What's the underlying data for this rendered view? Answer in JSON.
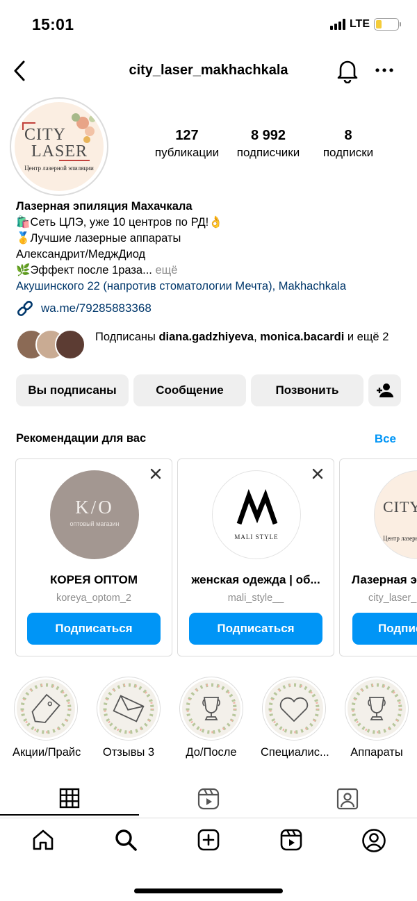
{
  "status": {
    "time": "15:01",
    "network": "LTE",
    "battery_level": 0.28,
    "battery_color": "#f4cc3a"
  },
  "header": {
    "username": "city_laser_makhachkala"
  },
  "profile": {
    "avatar": {
      "line1": "CITY",
      "line2": "LASER",
      "caption": "Центр лазерной эпиляции"
    },
    "stats": [
      {
        "num": "127",
        "label": "публикации"
      },
      {
        "num": "8 992",
        "label": "подписчики"
      },
      {
        "num": "8",
        "label": "подписки"
      }
    ],
    "bio": {
      "name": "Лазерная эпиляция Махачкала",
      "line1": "🛍️Сеть ЦЛЭ, уже 10 центров по РД!👌",
      "line2": "🥇Лучшие лазерные аппараты",
      "line3": "Александрит/МеджДиод",
      "line4": "🌿Эффект после 1раза...",
      "more": " ещё",
      "address": "Акушинского 22 (напротив стоматологии Мечта), Makhachkala"
    },
    "link": "wa.me/79285883368",
    "mutual": {
      "prefix": "Подписаны ",
      "user1": "diana.gadzhiyeva",
      "sep": ", ",
      "user2": "monica.bacardi",
      "suffix": " и ещё 2"
    }
  },
  "actions": {
    "following": "Вы подписаны",
    "message": "Сообщение",
    "call": "Позвонить"
  },
  "suggestions": {
    "title": "Рекомендации для вас",
    "see_all": "Все",
    "follow_label": "Подписаться",
    "cards": [
      {
        "name": "КОРЕЯ ОПТОМ",
        "username": "koreya_optom_2",
        "logo_text": "K/O",
        "logo_sub": "оптовый магазин",
        "bg": "#a39791"
      },
      {
        "name": "женская одежда | об...",
        "username": "mali_style__",
        "logo_text": "M",
        "logo_sub": "MALI STYLE",
        "bg": "#ffffff"
      },
      {
        "name": "Лазерная э",
        "username": "city_laser_",
        "logo_text": "CITY LAS",
        "logo_sub": "Центр лазерн",
        "bg": "#fbeee2"
      }
    ]
  },
  "highlights": [
    {
      "label": "Акции/Прайс",
      "icon": "sale-tag-icon"
    },
    {
      "label": "Отзывы 3",
      "icon": "envelope-icon"
    },
    {
      "label": "До/После",
      "icon": "trophy-icon"
    },
    {
      "label": "Специалис...",
      "icon": "heart-icon"
    },
    {
      "label": "Аппараты",
      "icon": "trophy-icon"
    }
  ],
  "tabs": [
    "grid-icon",
    "reels-icon",
    "tagged-icon"
  ],
  "nav": [
    "home-icon",
    "search-icon",
    "create-icon",
    "reels-icon",
    "profile-icon"
  ],
  "colors": {
    "accent": "#0095f6",
    "link": "#00376b",
    "muted": "#8e8e8e"
  }
}
